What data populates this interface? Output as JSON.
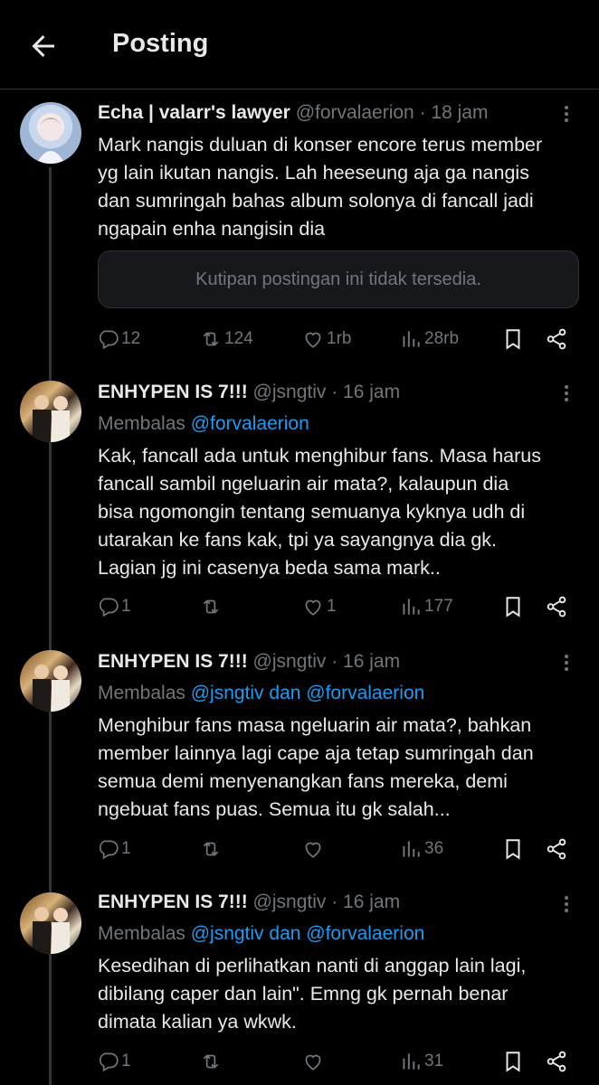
{
  "header": {
    "title": "Posting"
  },
  "posts": [
    {
      "name": "Echa | valarr's lawyer",
      "handle": "@forvalaerion",
      "time": "· 18 jam",
      "reply_prefix": "",
      "reply_mentions": "",
      "lines": [
        "Mark nangis duluan di konser encore terus member",
        "yg lain ikutan nangis. Lah heeseung aja ga nangis",
        "dan sumringah bahas album solonya di fancall jadi",
        "ngapain enha nangisin dia"
      ],
      "quote": "Kutipan postingan ini tidak tersedia.",
      "stats": {
        "replies": "12",
        "reposts": "124",
        "likes": "1rb",
        "views": "28rb"
      }
    },
    {
      "name": "ENHYPEN IS 7!!!",
      "handle": "@jsngtiv",
      "time": "· 16 jam",
      "reply_prefix": "Membalas",
      "reply_mentions": "@forvalaerion",
      "lines": [
        "Kak, fancall ada untuk menghibur fans. Masa harus",
        "fancall sambil ngeluarin air mata?, kalaupun dia",
        "bisa ngomongin tentang semuanya kyknya udh di",
        "utarakan ke fans kak, tpi ya sayangnya dia gk.",
        "Lagian jg ini casenya beda sama mark.."
      ],
      "stats": {
        "replies": "1",
        "reposts": "",
        "likes": "1",
        "views": "177"
      }
    },
    {
      "name": "ENHYPEN IS 7!!!",
      "handle": "@jsngtiv",
      "time": "· 16 jam",
      "reply_prefix": "Membalas",
      "reply_mentions": "@jsngtiv dan @forvalaerion",
      "lines": [
        "Menghibur fans masa ngeluarin air mata?, bahkan",
        "member lainnya lagi cape aja tetap sumringah dan",
        "semua demi menyenangkan fans mereka, demi",
        "ngebuat fans puas. Semua itu gk salah..."
      ],
      "stats": {
        "replies": "1",
        "reposts": "",
        "likes": "",
        "views": "36"
      }
    },
    {
      "name": "ENHYPEN IS 7!!!",
      "handle": "@jsngtiv",
      "time": "· 16 jam",
      "reply_prefix": "Membalas",
      "reply_mentions": "@jsngtiv dan @forvalaerion",
      "lines": [
        "Kesedihan di perlihatkan nanti di anggap lain lagi,",
        "dibilang caper dan lain\". Emng gk pernah benar",
        "dimata kalian ya wkwk."
      ],
      "stats": {
        "replies": "1",
        "reposts": "",
        "likes": "",
        "views": "31"
      }
    }
  ],
  "icons": {
    "back": "arrow-left-icon",
    "more": "more-icon",
    "reply": "reply-icon",
    "repost": "repost-icon",
    "like": "heart-icon",
    "views": "views-icon",
    "bookmark": "bookmark-icon",
    "share": "share-icon"
  },
  "colors": {
    "background": "#000000",
    "text": "#e7e9ea",
    "muted": "#71767b",
    "link": "#1d9bf0"
  }
}
